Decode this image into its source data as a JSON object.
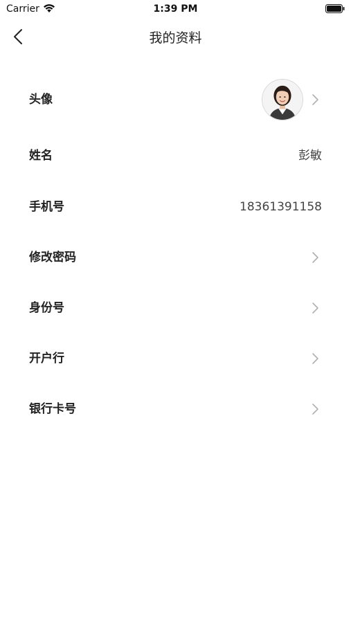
{
  "status_bar": {
    "carrier": "Carrier",
    "time": "1:39 PM"
  },
  "nav": {
    "title": "我的资料"
  },
  "rows": [
    {
      "label": "头像",
      "value": ""
    },
    {
      "label": "姓名",
      "value": "彭敏"
    },
    {
      "label": "手机号",
      "value": "18361391158"
    },
    {
      "label": "修改密码",
      "value": ""
    },
    {
      "label": "身份号",
      "value": ""
    },
    {
      "label": "开户行",
      "value": ""
    },
    {
      "label": "银行卡号",
      "value": ""
    }
  ]
}
